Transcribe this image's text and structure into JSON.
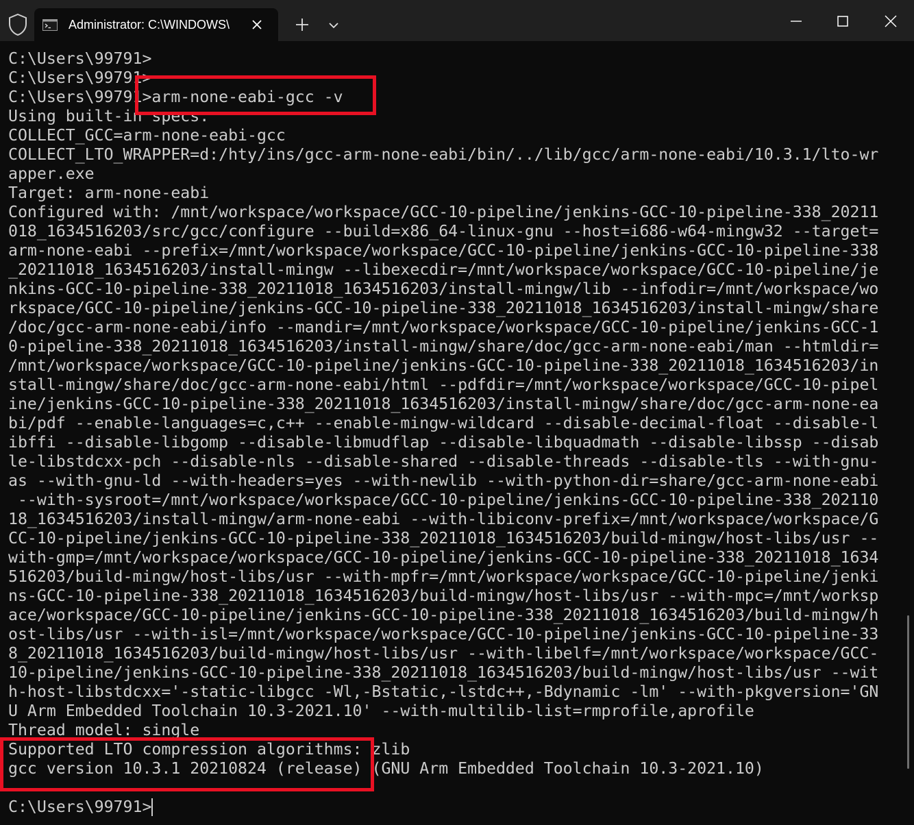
{
  "titlebar": {
    "tab_title": "Administrator: C:\\WINDOWS\\",
    "icons": {
      "shield": "shield-icon",
      "tab": "terminal-icon",
      "close_tab": "close-icon",
      "new_tab": "plus-icon",
      "dropdown": "chevron-down-icon",
      "minimize": "minimize-icon",
      "maximize": "maximize-icon",
      "close_window": "close-icon"
    }
  },
  "terminal": {
    "lines": [
      "C:\\Users\\99791>",
      "C:\\Users\\99791>",
      "C:\\Users\\99791>arm-none-eabi-gcc -v",
      "Using built-in specs.",
      "COLLECT_GCC=arm-none-eabi-gcc",
      "COLLECT_LTO_WRAPPER=d:/hty/ins/gcc-arm-none-eabi/bin/../lib/gcc/arm-none-eabi/10.3.1/lto-wr",
      "apper.exe",
      "Target: arm-none-eabi",
      "Configured with: /mnt/workspace/workspace/GCC-10-pipeline/jenkins-GCC-10-pipeline-338_20211",
      "018_1634516203/src/gcc/configure --build=x86_64-linux-gnu --host=i686-w64-mingw32 --target=",
      "arm-none-eabi --prefix=/mnt/workspace/workspace/GCC-10-pipeline/jenkins-GCC-10-pipeline-338",
      "_20211018_1634516203/install-mingw --libexecdir=/mnt/workspace/workspace/GCC-10-pipeline/je",
      "nkins-GCC-10-pipeline-338_20211018_1634516203/install-mingw/lib --infodir=/mnt/workspace/wo",
      "rkspace/GCC-10-pipeline/jenkins-GCC-10-pipeline-338_20211018_1634516203/install-mingw/share",
      "/doc/gcc-arm-none-eabi/info --mandir=/mnt/workspace/workspace/GCC-10-pipeline/jenkins-GCC-1",
      "0-pipeline-338_20211018_1634516203/install-mingw/share/doc/gcc-arm-none-eabi/man --htmldir=",
      "/mnt/workspace/workspace/GCC-10-pipeline/jenkins-GCC-10-pipeline-338_20211018_1634516203/in",
      "stall-mingw/share/doc/gcc-arm-none-eabi/html --pdfdir=/mnt/workspace/workspace/GCC-10-pipel",
      "ine/jenkins-GCC-10-pipeline-338_20211018_1634516203/install-mingw/share/doc/gcc-arm-none-ea",
      "bi/pdf --enable-languages=c,c++ --enable-mingw-wildcard --disable-decimal-float --disable-l",
      "ibffi --disable-libgomp --disable-libmudflap --disable-libquadmath --disable-libssp --disab",
      "le-libstdcxx-pch --disable-nls --disable-shared --disable-threads --disable-tls --with-gnu-",
      "as --with-gnu-ld --with-headers=yes --with-newlib --with-python-dir=share/gcc-arm-none-eabi",
      " --with-sysroot=/mnt/workspace/workspace/GCC-10-pipeline/jenkins-GCC-10-pipeline-338_202110",
      "18_1634516203/install-mingw/arm-none-eabi --with-libiconv-prefix=/mnt/workspace/workspace/G",
      "CC-10-pipeline/jenkins-GCC-10-pipeline-338_20211018_1634516203/build-mingw/host-libs/usr --",
      "with-gmp=/mnt/workspace/workspace/GCC-10-pipeline/jenkins-GCC-10-pipeline-338_20211018_1634",
      "516203/build-mingw/host-libs/usr --with-mpfr=/mnt/workspace/workspace/GCC-10-pipeline/jenki",
      "ns-GCC-10-pipeline-338_20211018_1634516203/build-mingw/host-libs/usr --with-mpc=/mnt/worksp",
      "ace/workspace/GCC-10-pipeline/jenkins-GCC-10-pipeline-338_20211018_1634516203/build-mingw/h",
      "ost-libs/usr --with-isl=/mnt/workspace/workspace/GCC-10-pipeline/jenkins-GCC-10-pipeline-33",
      "8_20211018_1634516203/build-mingw/host-libs/usr --with-libelf=/mnt/workspace/workspace/GCC-",
      "10-pipeline/jenkins-GCC-10-pipeline-338_20211018_1634516203/build-mingw/host-libs/usr --wit",
      "h-host-libstdcxx='-static-libgcc -Wl,-Bstatic,-lstdc++,-Bdynamic -lm' --with-pkgversion='GN",
      "U Arm Embedded Toolchain 10.3-2021.10' --with-multilib-list=rmprofile,aprofile",
      "Thread model: single",
      "Supported LTO compression algorithms: zlib",
      "gcc version 10.3.1 20210824 (release) (GNU Arm Embedded Toolchain 10.3-2021.10)",
      "",
      "C:\\Users\\99791>"
    ]
  },
  "colors": {
    "terminal_background": "#0c0c0c",
    "terminal_text": "#cccccc",
    "titlebar_background": "#202020",
    "highlight_border": "#e81123"
  }
}
